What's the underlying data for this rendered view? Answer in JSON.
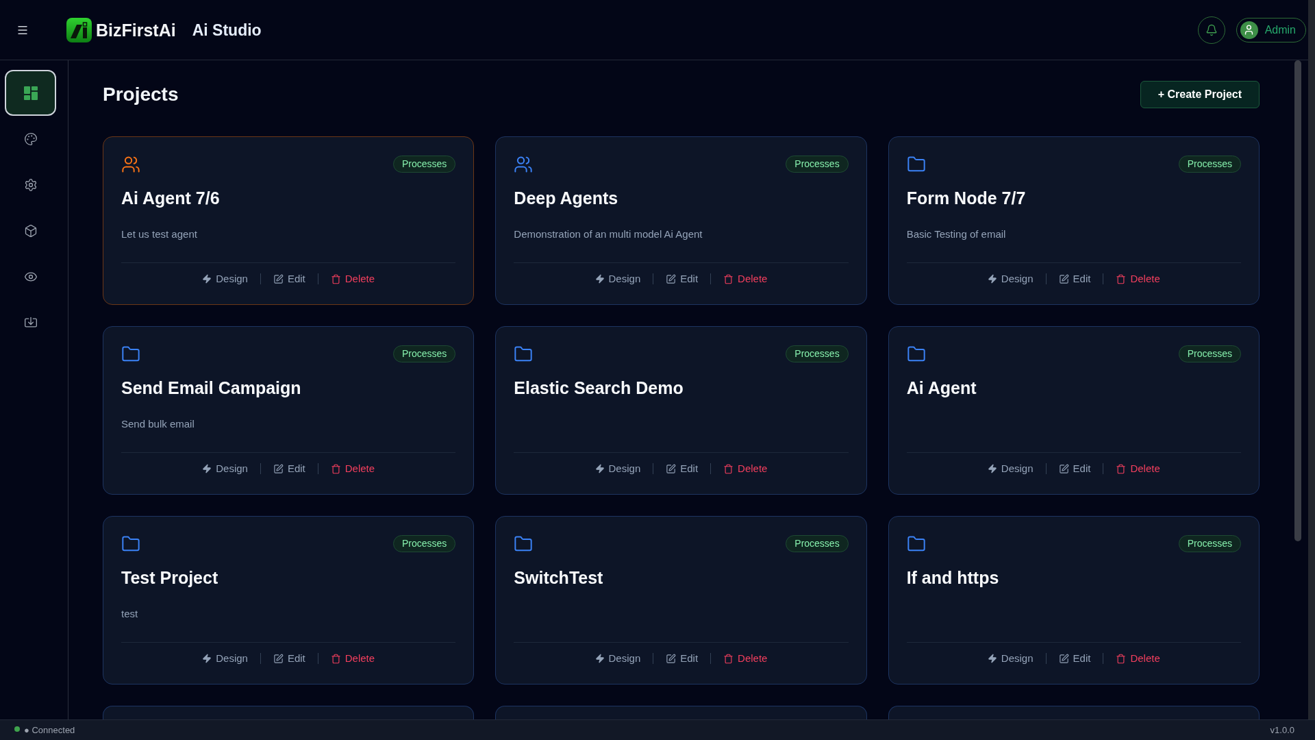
{
  "header": {
    "brand": "BizFirstAi",
    "app_name": "Ai Studio",
    "user": {
      "name": "Admin"
    }
  },
  "sidebar": {
    "items": [
      {
        "selected": true
      },
      {
        "selected": false
      },
      {
        "selected": false
      },
      {
        "selected": false
      },
      {
        "selected": false
      },
      {
        "selected": false
      }
    ]
  },
  "page": {
    "title": "Projects",
    "create_button": "+ Create Project"
  },
  "projects": [
    {
      "kind": "team",
      "selected": true,
      "title": "Ai Agent 7/6",
      "badge": "Processes",
      "description": "Let us test agent",
      "actions": [
        {
          "kind": "design",
          "label": "Design"
        },
        {
          "kind": "edit",
          "label": "Edit"
        },
        {
          "kind": "delete",
          "label": "Delete"
        }
      ]
    },
    {
      "kind": "team",
      "selected": false,
      "title": "Deep Agents",
      "badge": "Processes",
      "description": "Demonstration of an multi model Ai Agent",
      "actions": [
        {
          "kind": "design",
          "label": "Design"
        },
        {
          "kind": "edit",
          "label": "Edit"
        },
        {
          "kind": "delete",
          "label": "Delete"
        }
      ]
    },
    {
      "kind": "folder",
      "selected": false,
      "title": "Form Node 7/7",
      "badge": "Processes",
      "description": "Basic Testing of email",
      "actions": [
        {
          "kind": "design",
          "label": "Design"
        },
        {
          "kind": "edit",
          "label": "Edit"
        },
        {
          "kind": "delete",
          "label": "Delete"
        }
      ]
    },
    {
      "kind": "folder",
      "selected": false,
      "title": "Send Email Campaign",
      "badge": "Processes",
      "description": "Send bulk email",
      "actions": [
        {
          "kind": "design",
          "label": "Design"
        },
        {
          "kind": "edit",
          "label": "Edit"
        },
        {
          "kind": "delete",
          "label": "Delete"
        }
      ]
    },
    {
      "kind": "folder",
      "selected": false,
      "title": "Elastic Search Demo",
      "badge": "Processes",
      "actions": [
        {
          "kind": "design",
          "label": "Design"
        },
        {
          "kind": "edit",
          "label": "Edit"
        },
        {
          "kind": "delete",
          "label": "Delete"
        }
      ]
    },
    {
      "kind": "folder",
      "selected": false,
      "title": "Ai Agent",
      "badge": "Processes",
      "actions": [
        {
          "kind": "design",
          "label": "Design"
        },
        {
          "kind": "edit",
          "label": "Edit"
        },
        {
          "kind": "delete",
          "label": "Delete"
        }
      ]
    },
    {
      "kind": "folder",
      "selected": false,
      "title": "Test Project",
      "badge": "Processes",
      "description": "test",
      "actions": [
        {
          "kind": "design",
          "label": "Design"
        },
        {
          "kind": "edit",
          "label": "Edit"
        },
        {
          "kind": "delete",
          "label": "Delete"
        }
      ]
    },
    {
      "kind": "folder",
      "selected": false,
      "title": "SwitchTest",
      "badge": "Processes",
      "actions": [
        {
          "kind": "design",
          "label": "Design"
        },
        {
          "kind": "edit",
          "label": "Edit"
        },
        {
          "kind": "delete",
          "label": "Delete"
        }
      ]
    },
    {
      "kind": "folder",
      "selected": false,
      "title": "If and https",
      "badge": "Processes",
      "actions": [
        {
          "kind": "design",
          "label": "Design"
        },
        {
          "kind": "edit",
          "label": "Edit"
        },
        {
          "kind": "delete",
          "label": "Delete"
        }
      ]
    }
  ],
  "status_bar": {
    "connected": true,
    "label": "● Connected",
    "version": "v1.0.0"
  }
}
